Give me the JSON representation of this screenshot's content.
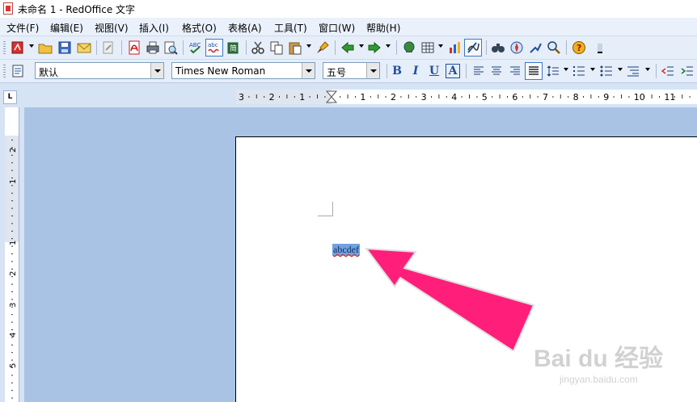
{
  "window": {
    "title": "未命名 1 - RedOffice 文字"
  },
  "menu": [
    "文件(F)",
    "编辑(E)",
    "视图(V)",
    "插入(I)",
    "格式(O)",
    "表格(A)",
    "工具(T)",
    "窗口(W)",
    "帮助(H)"
  ],
  "toolbar2": {
    "style_value": "默认",
    "font_value": "Times New Roman",
    "size_value": "五号",
    "bold_label": "B",
    "italic_label": "I",
    "underline_label": "U",
    "shadow_label": "A"
  },
  "ruler": {
    "horizontal_labels": [
      "3",
      "2",
      "1",
      "1",
      "2",
      "3",
      "4",
      "5",
      "6",
      "7",
      "8",
      "9",
      "10",
      "11"
    ],
    "vertical_labels": [
      "2",
      "1",
      "1",
      "2",
      "3",
      "4",
      "5"
    ]
  },
  "document": {
    "selected_text": "abcdef"
  },
  "annotation": {
    "arrow_color": "#ff1f7a"
  },
  "watermark": {
    "brand": "Bai du 经验",
    "site": "jingyan.baidu.com"
  },
  "colors": {
    "workspace": "#a9c3e4",
    "selection": "#6ea2e0",
    "toolbar": "#e6eef9"
  }
}
